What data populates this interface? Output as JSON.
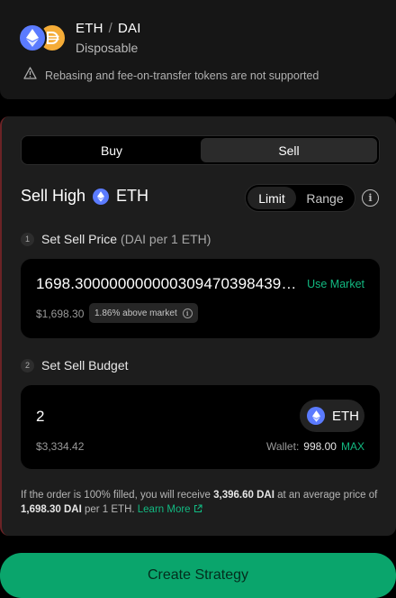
{
  "header": {
    "base_token": "ETH",
    "separator": "/",
    "quote_token": "DAI",
    "strategy_type": "Disposable",
    "warning": "Rebasing and fee-on-transfer tokens are not supported"
  },
  "panel": {
    "buy_label": "Buy",
    "sell_label": "Sell",
    "selected_side": "Sell",
    "section_title": "Sell High",
    "section_token": "ETH",
    "limit_label": "Limit",
    "range_label": "Range",
    "selected_mode": "Limit",
    "step1": {
      "number": "1",
      "title": "Set Sell Price",
      "unit": "(DAI per 1 ETH)"
    },
    "price": {
      "value": "1698.30000000000030947039843977...",
      "use_market": "Use Market",
      "usd": "$1,698.30",
      "badge": "1.86% above market"
    },
    "step2": {
      "number": "2",
      "title": "Set Sell Budget"
    },
    "budget": {
      "value": "2",
      "token": "ETH",
      "usd": "$3,334.42",
      "wallet_label": "Wallet:",
      "wallet_balance": "998.00",
      "max_label": "MAX"
    },
    "summary": {
      "part1": "If the order is 100% filled, you will receive ",
      "receive_amount": "3,396.60 DAI",
      "part2": " at an average price of ",
      "avg_price": "1,698.30 DAI",
      "part3": " per 1 ETH. ",
      "learn_more": "Learn More"
    }
  },
  "cta": {
    "label": "Create Strategy"
  },
  "colors": {
    "accent_green": "#12b981",
    "button_green": "#0aa56c",
    "eth_blue": "#5b7bff",
    "dai_orange": "#f5ac37",
    "sell_border_red": "#6b2326"
  }
}
